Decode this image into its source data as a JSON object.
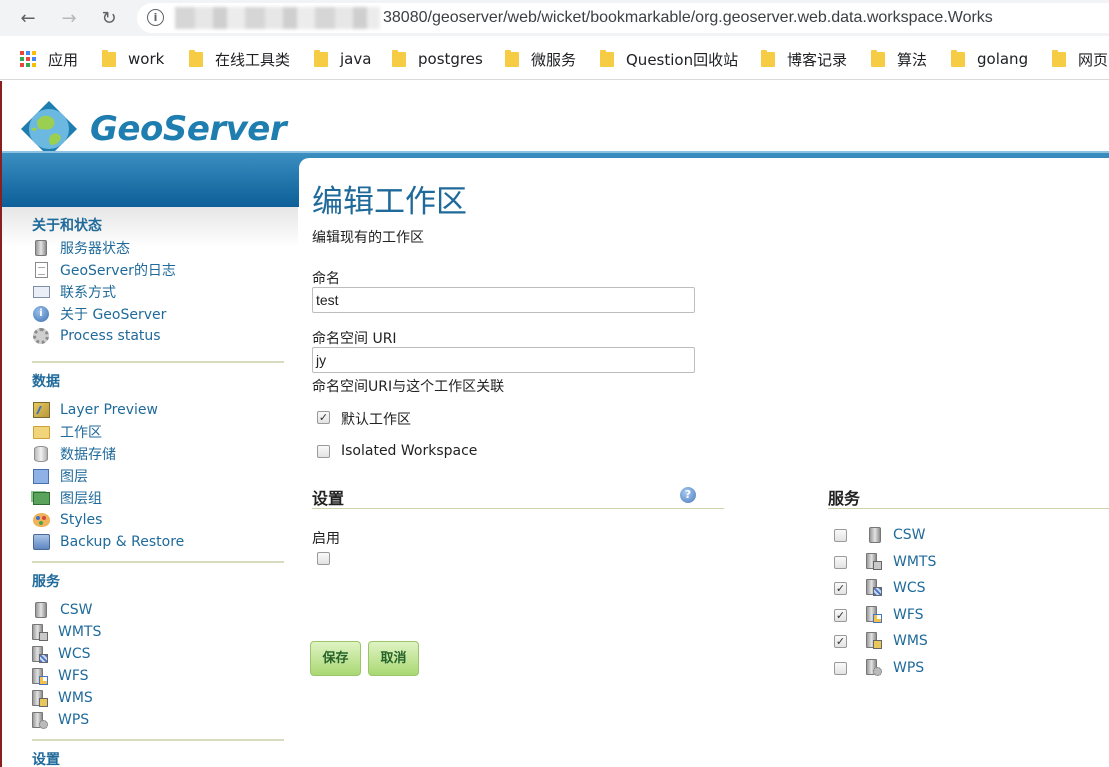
{
  "browser": {
    "url_visible": "38080/geoserver/web/wicket/bookmarkable/org.geoserver.web.data.workspace.Works",
    "bookmarks": [
      {
        "label": "应用",
        "icon": "apps-grid-icon"
      },
      {
        "label": "work",
        "icon": "folder-icon"
      },
      {
        "label": "在线工具类",
        "icon": "folder-icon"
      },
      {
        "label": "java",
        "icon": "folder-icon"
      },
      {
        "label": "postgres",
        "icon": "folder-icon"
      },
      {
        "label": "微服务",
        "icon": "folder-icon"
      },
      {
        "label": "Question回收站",
        "icon": "folder-icon"
      },
      {
        "label": "博客记录",
        "icon": "folder-icon"
      },
      {
        "label": "算法",
        "icon": "folder-icon"
      },
      {
        "label": "golang",
        "icon": "folder-icon"
      },
      {
        "label": "网页",
        "icon": "folder-icon"
      }
    ]
  },
  "header": {
    "logo_text": "GeoServer"
  },
  "sidebar": {
    "sections": [
      {
        "title": "关于和状态",
        "items": [
          {
            "label": "服务器状态",
            "icon": "server-status-icon"
          },
          {
            "label": "GeoServer的日志",
            "icon": "log-icon"
          },
          {
            "label": "联系方式",
            "icon": "contact-card-icon"
          },
          {
            "label": "关于 GeoServer",
            "icon": "info-icon"
          },
          {
            "label": "Process status",
            "icon": "gear-icon"
          }
        ]
      },
      {
        "title": "数据",
        "items": [
          {
            "label": "Layer Preview",
            "icon": "map-icon"
          },
          {
            "label": "工作区",
            "icon": "folder-icon"
          },
          {
            "label": "数据存储",
            "icon": "database-icon"
          },
          {
            "label": "图层",
            "icon": "layer-icon"
          },
          {
            "label": "图层组",
            "icon": "layer-group-icon"
          },
          {
            "label": "Styles",
            "icon": "palette-icon"
          },
          {
            "label": "Backup & Restore",
            "icon": "backup-icon"
          }
        ]
      },
      {
        "title": "服务",
        "items": [
          {
            "label": "CSW",
            "icon": "csw-icon"
          },
          {
            "label": "WMTS",
            "icon": "wmts-icon"
          },
          {
            "label": "WCS",
            "icon": "wcs-icon"
          },
          {
            "label": "WFS",
            "icon": "wfs-icon"
          },
          {
            "label": "WMS",
            "icon": "wms-icon"
          },
          {
            "label": "WPS",
            "icon": "wps-icon"
          }
        ]
      },
      {
        "title": "设置",
        "items": []
      }
    ]
  },
  "main": {
    "title": "编辑工作区",
    "description": "编辑现有的工作区",
    "name_label": "命名",
    "name_value": "test",
    "uri_label": "命名空间 URI",
    "uri_value": "jy",
    "uri_hint": "命名空间URI与这个工作区关联",
    "default_checkbox": {
      "label": "默认工作区",
      "checked": true
    },
    "isolated_checkbox": {
      "label": "Isolated Workspace",
      "checked": false
    },
    "settings": {
      "title": "设置",
      "enabled_label": "启用",
      "enabled": false
    },
    "services": {
      "title": "服务",
      "items": [
        {
          "label": "CSW",
          "checked": false
        },
        {
          "label": "WMTS",
          "checked": false
        },
        {
          "label": "WCS",
          "checked": true
        },
        {
          "label": "WFS",
          "checked": true
        },
        {
          "label": "WMS",
          "checked": true
        },
        {
          "label": "WPS",
          "checked": false
        }
      ]
    },
    "save_label": "保存",
    "cancel_label": "取消"
  }
}
